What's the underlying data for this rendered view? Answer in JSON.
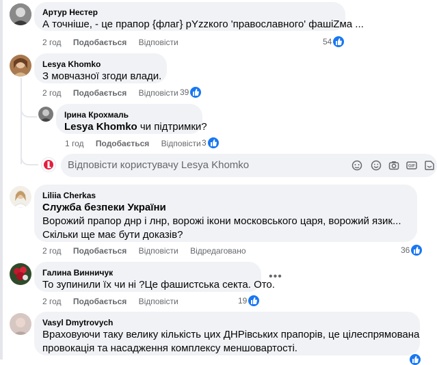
{
  "comments": [
    {
      "author": "Артур Нестер",
      "text": "А точніше, - це прапор {флаг} pYzzкого 'православного' фашіZма ...",
      "time": "2 год",
      "like_label": "Подобається",
      "reply_label": "Відповісти",
      "likes": "54"
    },
    {
      "author": "Lesya Khomko",
      "text": "З мовчазної згоди влади.",
      "time": "2 год",
      "like_label": "Подобається",
      "reply_label": "Відповісти",
      "likes": "39"
    },
    {
      "author": "Ірина Крохмаль",
      "mention": "Lesya Khomko",
      "text": " чи підтримки?",
      "time": "1 год",
      "like_label": "Подобається",
      "reply_label": "Відповісти",
      "likes": "3"
    },
    {
      "author": "Liliia Cherkas",
      "mention": "Служба безпеки України",
      "text_line1": "Ворожий прапор днр і лнр, ворожі ікони московського царя, ворожий язик...",
      "text_line2": "Скільки ще має бути доказів?",
      "time": "2 год",
      "like_label": "Подобається",
      "reply_label": "Відповісти",
      "edited_label": "Відредаговано",
      "likes": "36"
    },
    {
      "author": "Галина Винничук",
      "text": "То зупинили їх чи ні ?Це фашистська секта. Ото.",
      "time": "2 год",
      "like_label": "Подобається",
      "reply_label": "Відповісти",
      "likes": "19"
    },
    {
      "author": "Vasyl Dmytrovych",
      "text_line1": "Враховуючи таку велику кількість цих ДНРівських прапорів, це цілеспрямована",
      "text_line2": "провокація та насадження комплексу меншовартості."
    }
  ],
  "reply_box": {
    "placeholder": "Відповісти користувачу Lesya Khomko"
  },
  "icons": [
    "like-icon",
    "more-icon",
    "avatar-sticker-icon",
    "emoji-icon",
    "camera-icon",
    "gif-icon",
    "sticker-icon"
  ],
  "colors": {
    "accent": "#1877f2",
    "bubble": "#f0f2f5",
    "meta": "#65676b"
  }
}
